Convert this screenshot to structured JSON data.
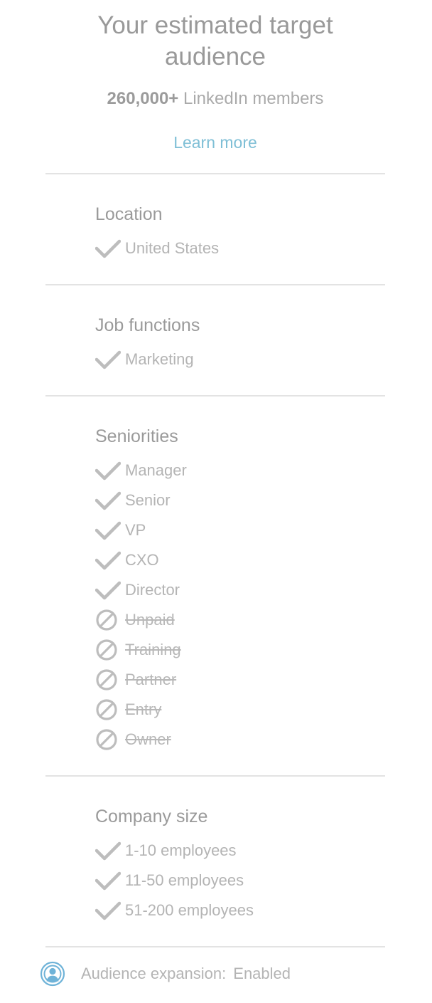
{
  "header": {
    "title_line1": "Your estimated target",
    "title_line2": "audience",
    "member_count": "260,000+",
    "member_suffix": "LinkedIn members",
    "learn_more": "Learn more"
  },
  "colors": {
    "accent": "#7fbfd6",
    "check": "#bdbdbd",
    "divider": "#e3e3e3",
    "expansion_icon": "#6fb3d8"
  },
  "sections": {
    "location": {
      "title": "Location",
      "items": [
        {
          "label": "United States",
          "status": "included",
          "icon": "check-icon"
        }
      ]
    },
    "job_functions": {
      "title": "Job functions",
      "items": [
        {
          "label": "Marketing",
          "status": "included",
          "icon": "check-icon"
        }
      ]
    },
    "seniorities": {
      "title": "Seniorities",
      "items": [
        {
          "label": "Manager",
          "status": "included",
          "icon": "check-icon"
        },
        {
          "label": "Senior",
          "status": "included",
          "icon": "check-icon"
        },
        {
          "label": "VP",
          "status": "included",
          "icon": "check-icon"
        },
        {
          "label": "CXO",
          "status": "included",
          "icon": "check-icon"
        },
        {
          "label": "Director",
          "status": "included",
          "icon": "check-icon"
        },
        {
          "label": "Unpaid",
          "status": "excluded",
          "icon": "prohibited-icon"
        },
        {
          "label": "Training",
          "status": "excluded",
          "icon": "prohibited-icon"
        },
        {
          "label": "Partner",
          "status": "excluded",
          "icon": "prohibited-icon"
        },
        {
          "label": "Entry",
          "status": "excluded",
          "icon": "prohibited-icon"
        },
        {
          "label": "Owner",
          "status": "excluded",
          "icon": "prohibited-icon"
        }
      ]
    },
    "company_size": {
      "title": "Company size",
      "items": [
        {
          "label": "1-10 employees",
          "status": "included",
          "icon": "check-icon"
        },
        {
          "label": "11-50 employees",
          "status": "included",
          "icon": "check-icon"
        },
        {
          "label": "51-200 employees",
          "status": "included",
          "icon": "check-icon"
        }
      ]
    }
  },
  "footer": {
    "label": "Audience expansion:",
    "value": "Enabled",
    "icon": "audience-expansion-icon"
  }
}
